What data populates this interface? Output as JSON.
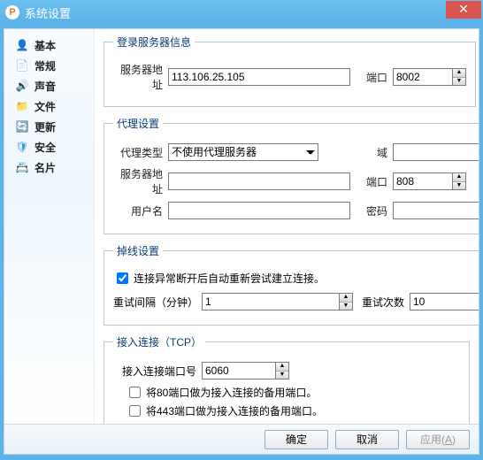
{
  "window": {
    "title": "系统设置"
  },
  "sidebar": {
    "items": [
      {
        "label": "基本"
      },
      {
        "label": "常规"
      },
      {
        "label": "声音"
      },
      {
        "label": "文件"
      },
      {
        "label": "更新"
      },
      {
        "label": "安全"
      },
      {
        "label": "名片"
      }
    ]
  },
  "login": {
    "legend": "登录服务器信息",
    "server_label": "服务器地址",
    "server_value": "113.106.25.105",
    "port_label": "端口",
    "port_value": "8002"
  },
  "proxy": {
    "legend": "代理设置",
    "type_label": "代理类型",
    "type_value": "不使用代理服务器",
    "domain_label": "域",
    "domain_value": "",
    "server_label": "服务器地址",
    "server_value": "",
    "port_label": "端口",
    "port_value": "808",
    "user_label": "用户名",
    "user_value": "",
    "pass_label": "密码",
    "pass_value": ""
  },
  "reconnect": {
    "legend": "掉线设置",
    "auto_label": "连接异常断开后自动重新尝试建立连接。",
    "interval_label": "重试间隔（分钟）",
    "interval_value": "1",
    "count_label": "重试次数",
    "count_value": "10"
  },
  "tcp": {
    "legend": "接入连接（TCP）",
    "port_label": "接入连接端口号",
    "port_value": "6060",
    "opt80": "将80端口做为接入连接的备用端口。",
    "opt443": "将443端口做为接入连接的备用端口。"
  },
  "buttons": {
    "ok": "确定",
    "cancel": "取消",
    "apply": "应用(A)"
  }
}
